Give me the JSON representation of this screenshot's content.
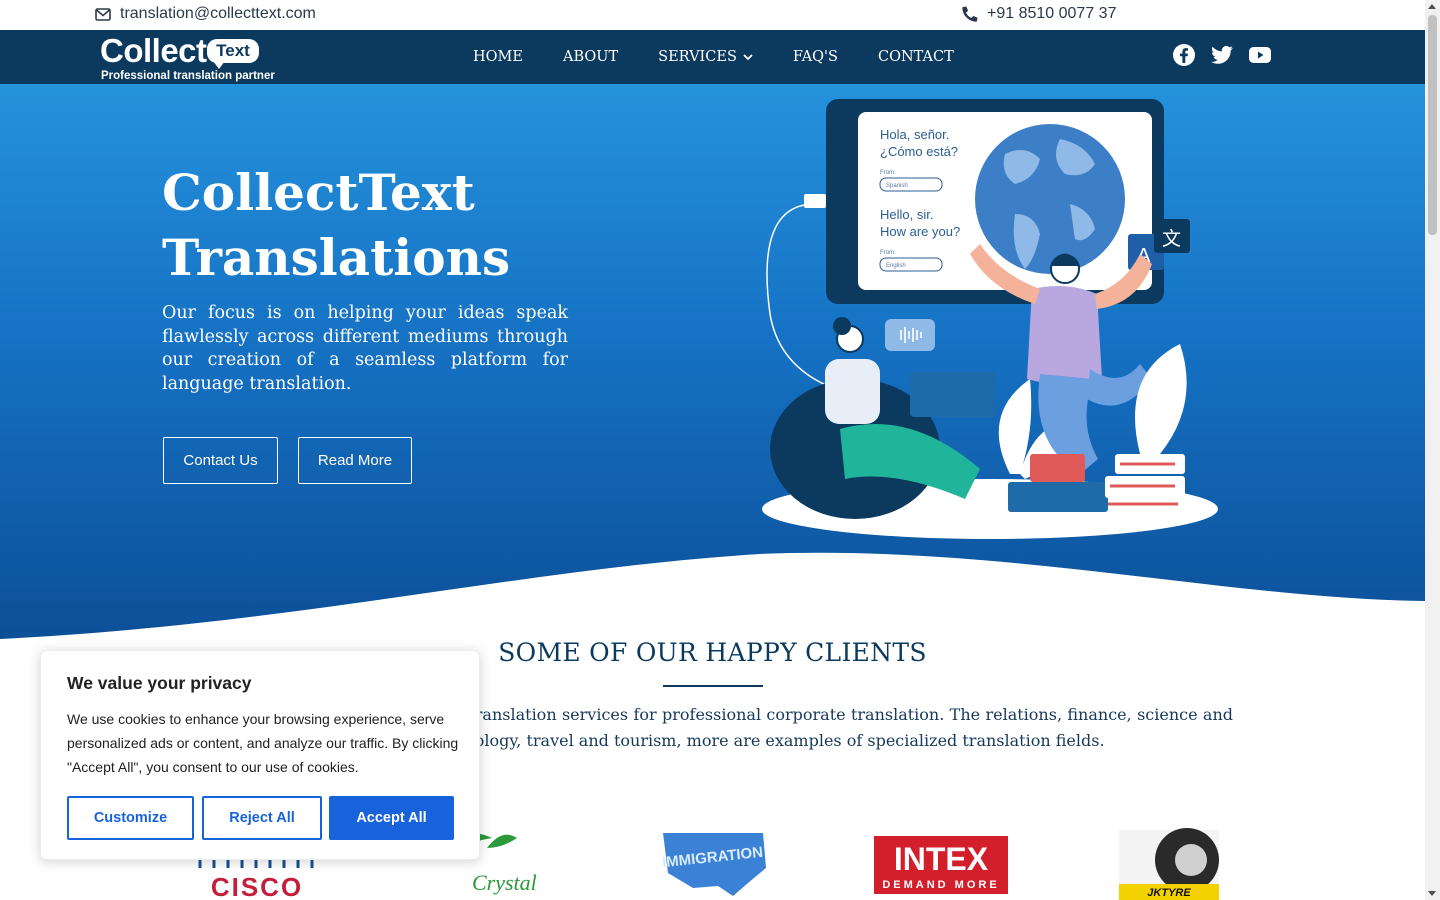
{
  "topbar": {
    "email": "translation@collecttext.com",
    "phone": "+91 8510 0077 37"
  },
  "logo": {
    "brand": "Collect",
    "bubble": "Text",
    "tagline": "Professional translation partner"
  },
  "nav": {
    "items": [
      {
        "label": "HOME"
      },
      {
        "label": "ABOUT"
      },
      {
        "label": "SERVICES",
        "has_dropdown": true
      },
      {
        "label": "FAQ'S"
      },
      {
        "label": "CONTACT"
      }
    ],
    "socials": [
      "facebook-icon",
      "twitter-icon",
      "youtube-icon"
    ]
  },
  "hero": {
    "title_line1": "CollectText",
    "title_line2": "Translations",
    "lead": "Our focus is on helping your ideas speak flawlessly across different mediums through our creation of a seamless platform for language translation.",
    "contact_label": "Contact Us",
    "read_label": "Read More",
    "illustration": {
      "spanish_line1": "Hola, señor.",
      "spanish_line2": "¿Cómo está?",
      "english_line1": "Hello, sir.",
      "english_line2": "How are you?",
      "from_label": "From:",
      "select_spanish": "Spanish",
      "select_english": "English",
      "badge_a": "A",
      "badge_zh": "文"
    }
  },
  "clients": {
    "title": "SOME OF OUR HAPPY CLIENTS",
    "text": "ket segments use our specialized translation services for professional corporate translation. The relations, finance, science and technology, medicine and biotechnology, travel and tourism, more are examples of specialized translation fields.",
    "logos": {
      "cisco": "CISCO",
      "crystal": "Crystal",
      "immigration": "IMMIGRATION",
      "intex": "INTEX",
      "intex_tag": "DEMAND MORE",
      "jk": "JKTYRE"
    }
  },
  "cookie": {
    "title": "We value your privacy",
    "text": "We use cookies to enhance your browsing experience, serve personalized ads or content, and analyze our traffic. By clicking \"Accept All\", you consent to our use of cookies.",
    "customize": "Customize",
    "reject": "Reject All",
    "accept": "Accept All"
  },
  "colors": {
    "nav_bg": "#0b3a5e",
    "hero_top": "#2592dc",
    "hero_bottom": "#0c4f97",
    "accent": "#1863dc"
  }
}
